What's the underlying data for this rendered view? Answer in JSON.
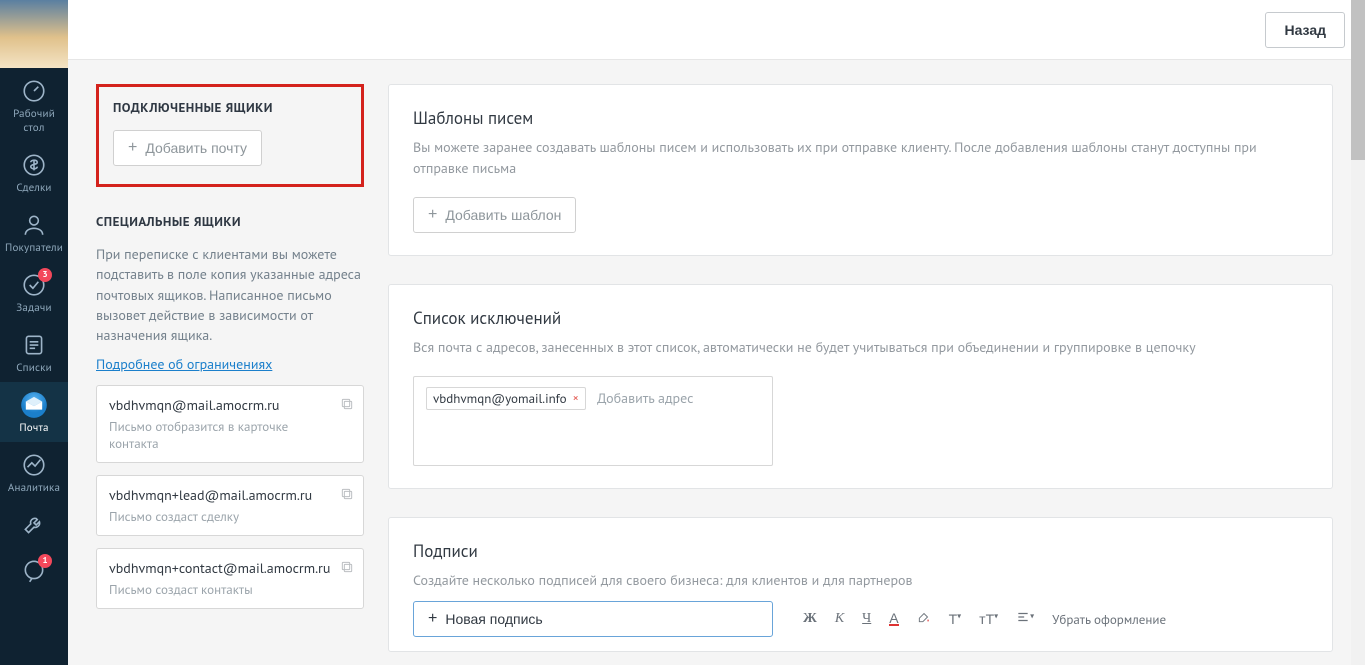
{
  "header": {
    "back_label": "Назад"
  },
  "nav": {
    "items": [
      {
        "id": "dashboard",
        "label": "Рабочий\nстол"
      },
      {
        "id": "deals",
        "label": "Сделки"
      },
      {
        "id": "buyers",
        "label": "Покупатели"
      },
      {
        "id": "tasks",
        "label": "Задачи",
        "badge": "3"
      },
      {
        "id": "lists",
        "label": "Списки"
      },
      {
        "id": "mail",
        "label": "Почта",
        "active": true
      },
      {
        "id": "analytics",
        "label": "Аналитика"
      },
      {
        "id": "settings",
        "label": ""
      },
      {
        "id": "chat",
        "label": "",
        "badge": "1"
      }
    ]
  },
  "left": {
    "connected_title": "Подключенные ящики",
    "add_mail": "Добавить почту",
    "special_title": "Специальные ящики",
    "special_desc": "При переписке с клиентами вы можете подставить в поле копия указанные адреса почтовых ящиков. Написанное письмо вызовет действие в зависимости от назначения ящика.",
    "more_link": "Подробнее об ограничениях",
    "boxes": [
      {
        "addr": "vbdhvmqn@mail.amocrm.ru",
        "desc": "Письмо отобразится в карточке контакта"
      },
      {
        "addr": "vbdhvmqn+lead@mail.amocrm.ru",
        "desc": "Письмо создаст сделку"
      },
      {
        "addr": "vbdhvmqn+contact@mail.amocrm.ru",
        "desc": "Письмо создаст контакты"
      }
    ]
  },
  "cards": {
    "templates": {
      "title": "Шаблоны писем",
      "sub": "Вы можете заранее создавать шаблоны писем и использовать их при отправке клиенту. После добавления шаблоны станут доступны при отправке письма",
      "button": "Добавить шаблон"
    },
    "excl": {
      "title": "Список исключений",
      "sub": "Вся почта с адресов, занесенных в этот список, автоматически не будет учитываться при объединении и группировке в цепочку",
      "emails": [
        "vbdhvmqn@yomail.info"
      ],
      "placeholder": "Добавить адрес"
    },
    "sign": {
      "title": "Подписи",
      "sub": "Создайте несколько подписей для своего бизнеса: для клиентов и для партнеров",
      "button": "Новая подпись",
      "toolbar": {
        "bold": "Ж",
        "italic": "К",
        "under": "Ч",
        "clear": "Убрать оформление"
      }
    }
  }
}
